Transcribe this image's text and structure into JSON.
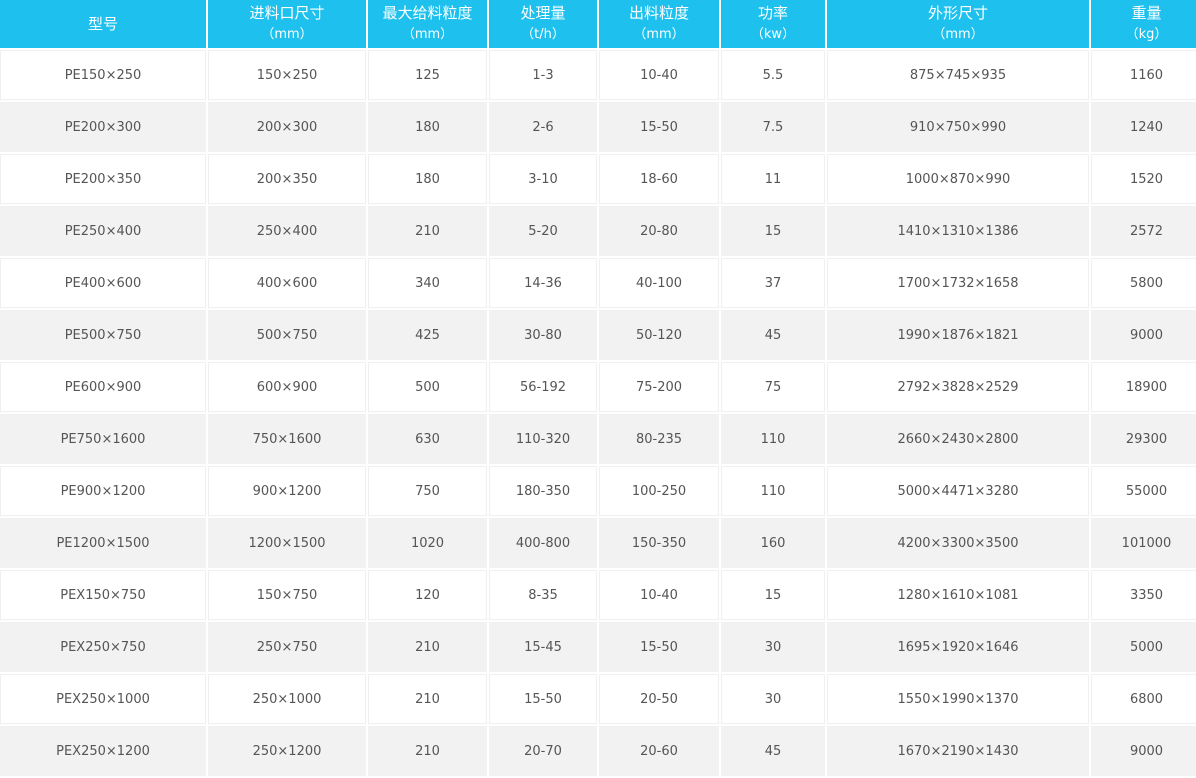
{
  "table": {
    "headers": [
      {
        "label": "型号",
        "unit": ""
      },
      {
        "label": "进料口尺寸",
        "unit": "（mm）"
      },
      {
        "label": "最大给料粒度",
        "unit": "（mm）"
      },
      {
        "label": "处理量",
        "unit": "（t/h）"
      },
      {
        "label": "出料粒度",
        "unit": "（mm）"
      },
      {
        "label": "功率",
        "unit": "（kw）"
      },
      {
        "label": "外形尺寸",
        "unit": "（mm）"
      },
      {
        "label": "重量",
        "unit": "（kg）"
      }
    ],
    "rows": [
      [
        "PE150×250",
        "150×250",
        "125",
        "1-3",
        "10-40",
        "5.5",
        "875×745×935",
        "1160"
      ],
      [
        "PE200×300",
        "200×300",
        "180",
        "2-6",
        "15-50",
        "7.5",
        "910×750×990",
        "1240"
      ],
      [
        "PE200×350",
        "200×350",
        "180",
        "3-10",
        "18-60",
        "11",
        "1000×870×990",
        "1520"
      ],
      [
        "PE250×400",
        "250×400",
        "210",
        "5-20",
        "20-80",
        "15",
        "1410×1310×1386",
        "2572"
      ],
      [
        "PE400×600",
        "400×600",
        "340",
        "14-36",
        "40-100",
        "37",
        "1700×1732×1658",
        "5800"
      ],
      [
        "PE500×750",
        "500×750",
        "425",
        "30-80",
        "50-120",
        "45",
        "1990×1876×1821",
        "9000"
      ],
      [
        "PE600×900",
        "600×900",
        "500",
        "56-192",
        "75-200",
        "75",
        "2792×3828×2529",
        "18900"
      ],
      [
        "PE750×1600",
        "750×1600",
        "630",
        "110-320",
        "80-235",
        "110",
        "2660×2430×2800",
        "29300"
      ],
      [
        "PE900×1200",
        "900×1200",
        "750",
        "180-350",
        "100-250",
        "110",
        "5000×4471×3280",
        "55000"
      ],
      [
        "PE1200×1500",
        "1200×1500",
        "1020",
        "400-800",
        "150-350",
        "160",
        "4200×3300×3500",
        "101000"
      ],
      [
        "PEX150×750",
        "150×750",
        "120",
        "8-35",
        "10-40",
        "15",
        "1280×1610×1081",
        "3350"
      ],
      [
        "PEX250×750",
        "250×750",
        "210",
        "15-45",
        "15-50",
        "30",
        "1695×1920×1646",
        "5000"
      ],
      [
        "PEX250×1000",
        "250×1000",
        "210",
        "15-50",
        "20-50",
        "30",
        "1550×1990×1370",
        "6800"
      ],
      [
        "PEX250×1200",
        "250×1200",
        "210",
        "20-70",
        "20-60",
        "45",
        "1670×2190×1430",
        "9000"
      ]
    ]
  },
  "colors": {
    "header_bg": "#1ec1ee",
    "header_text": "#ffffff",
    "row_alt_bg": "#f2f2f2",
    "cell_text": "#555555"
  }
}
